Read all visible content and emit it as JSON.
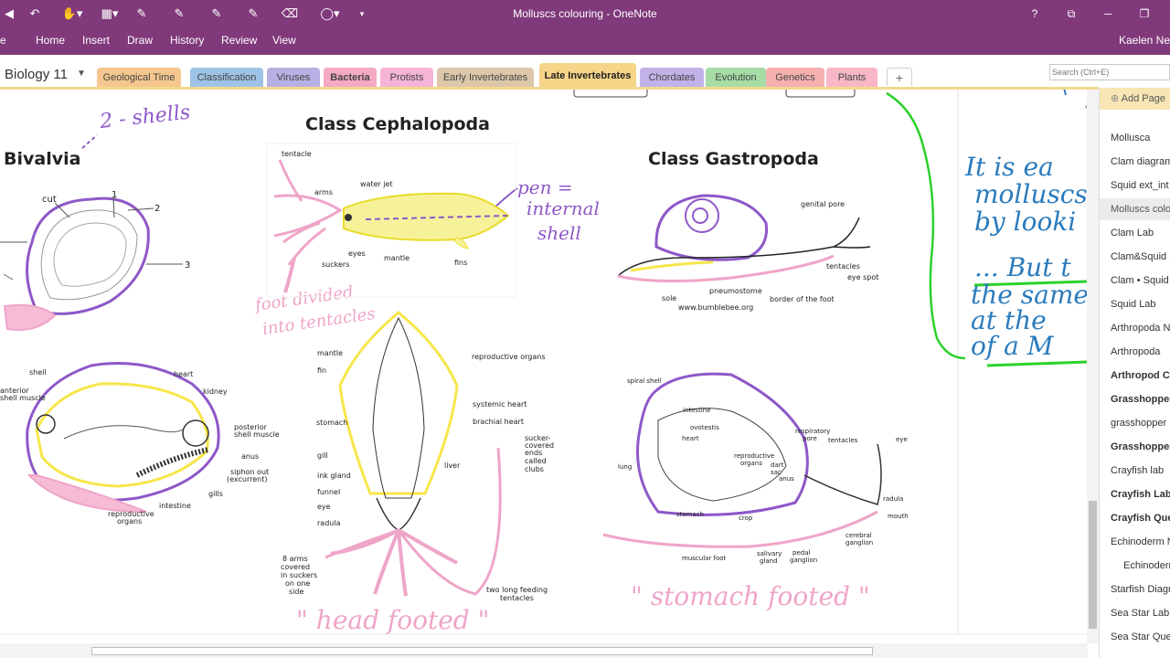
{
  "window": {
    "title": "Molluscs colouring - OneNote",
    "help": "?",
    "minimize": "─",
    "maximize": "❐",
    "restore": "⧉"
  },
  "ribbon": {
    "tabs": [
      "Home",
      "Insert",
      "Draw",
      "History",
      "Review",
      "View"
    ],
    "user": "Kaelen Ne",
    "file_fragment": "e"
  },
  "notebook": {
    "name": "Biology 11",
    "sections": [
      {
        "label": "Geological Time",
        "color": "#F5C78E"
      },
      {
        "label": "Classification",
        "color": "#9FC3E7"
      },
      {
        "label": "Viruses",
        "color": "#B7B0E2"
      },
      {
        "label": "Bacteria",
        "color": "#F4A9C5"
      },
      {
        "label": "Protists",
        "color": "#F6B4D6"
      },
      {
        "label": "Early Invertebrates",
        "color": "#DDC7AA"
      },
      {
        "label": "Late Invertebrates",
        "color": "#F6D488"
      },
      {
        "label": "Chordates",
        "color": "#C1B2E8"
      },
      {
        "label": "Evolution",
        "color": "#A6DDA6"
      },
      {
        "label": "Genetics",
        "color": "#F6B0B0"
      },
      {
        "label": "Plants",
        "color": "#F8B7C6"
      }
    ],
    "add_section": "+"
  },
  "search": {
    "placeholder": "Search (Ctrl+E)"
  },
  "pages": {
    "add_page": "Add Page",
    "items": [
      {
        "label": "Mollusca",
        "bold": false
      },
      {
        "label": "Clam diagram",
        "bold": false
      },
      {
        "label": "Squid ext_int",
        "bold": false
      },
      {
        "label": "Molluscs colou",
        "bold": false
      },
      {
        "label": "Clam Lab",
        "bold": false
      },
      {
        "label": "Clam&Squid C",
        "bold": false
      },
      {
        "label": "Clam • Squid",
        "bold": false
      },
      {
        "label": "Squid Lab",
        "bold": false
      },
      {
        "label": "Arthropoda N",
        "bold": false
      },
      {
        "label": "Arthropoda",
        "bold": false
      },
      {
        "label": "Arthropod Co",
        "bold": true
      },
      {
        "label": "Grasshopper",
        "bold": true
      },
      {
        "label": "grasshopper",
        "bold": false
      },
      {
        "label": "Grasshopper",
        "bold": true
      },
      {
        "label": "Crayfish lab",
        "bold": false
      },
      {
        "label": "Crayfish Lab",
        "bold": true
      },
      {
        "label": "Crayfish Ques",
        "bold": true
      },
      {
        "label": "Echinoderm N",
        "bold": false
      },
      {
        "label": "Echinoderm",
        "bold": false
      },
      {
        "label": "Starfish Diagra",
        "bold": false
      },
      {
        "label": "Sea Star Lab D",
        "bold": false
      },
      {
        "label": "Sea Star Quest",
        "bold": false
      }
    ]
  },
  "canvas": {
    "bivalvia_title": "Bivalvia",
    "cephalopoda_title": "Class Cephalopoda",
    "gastropoda_title": "Class Gastropoda",
    "bivalvia_note": "2 - shells",
    "pen_note": "pen = internal shell",
    "foot_note": "foot divided into tentacles",
    "head_footed": "\" head footed \"",
    "stomach_footed": "\" stomach footed \"",
    "side_note": "It is ea molluscs by looki ... But the same at the of a M",
    "labels": {
      "cut": "cut",
      "n1": "1",
      "n2": "2",
      "n3": "3",
      "tentacle": "tentacle",
      "water_jet": "water jet",
      "arms": "arms",
      "eyes": "eyes",
      "mantle": "mantle",
      "suckers": "suckers",
      "fins": "fins",
      "genital_pore": "genital pore",
      "tentacles": "tentacles",
      "eye_spot": "eye spot",
      "sole": "sole",
      "pneumostome": "pneumostome",
      "border_of_foot": "border of the foot",
      "bumblebee": "www.bumblebee.org",
      "shell": "shell",
      "heart": "heart",
      "kidney": "kidney",
      "anterior_shell_muscle": "anterior shell muscle",
      "posterior_shell_muscle": "posterior shell muscle",
      "anus": "anus",
      "siphon_out": "siphon out (excurrent)",
      "gills": "gills",
      "intestine": "intestine",
      "reproductive_organs": "reproductive organs",
      "sq_mantle": "mantle",
      "sq_fin": "fin",
      "sq_repro": "reproductive organs",
      "systemic_heart": "systemic heart",
      "brachial_heart": "brachial heart",
      "sq_stomach": "stomach",
      "gill": "gill",
      "liver": "liver",
      "ink_gland": "ink gland",
      "funnel": "funnel",
      "eye": "eye",
      "radula": "radula",
      "sucker_clubs": "sucker-covered ends called clubs",
      "eight_arms": "8 arms covered in suckers on one side",
      "two_tentacles": "two long feeding tentacles",
      "spiral_shell": "spiral shell",
      "sn_intestine": "intestine",
      "ovotestis": "ovotestis",
      "sn_heart": "heart",
      "sn_repro": "reproductive organs",
      "dart_sac": "dart sac",
      "resp_pore": "respiratory pore",
      "sn_tentacles": "tentacles",
      "sn_eye": "eye",
      "lung": "lung",
      "sn_stomach": "stomach",
      "crop": "crop",
      "sn_radula": "radula",
      "mouth": "mouth",
      "cerebral_ganglion": "cerebral ganglion",
      "muscular_foot": "muscular foot",
      "salivary_gland": "salivary gland",
      "pedal_ganglion": "pedal ganglion",
      "sn_anus": "anus"
    }
  }
}
